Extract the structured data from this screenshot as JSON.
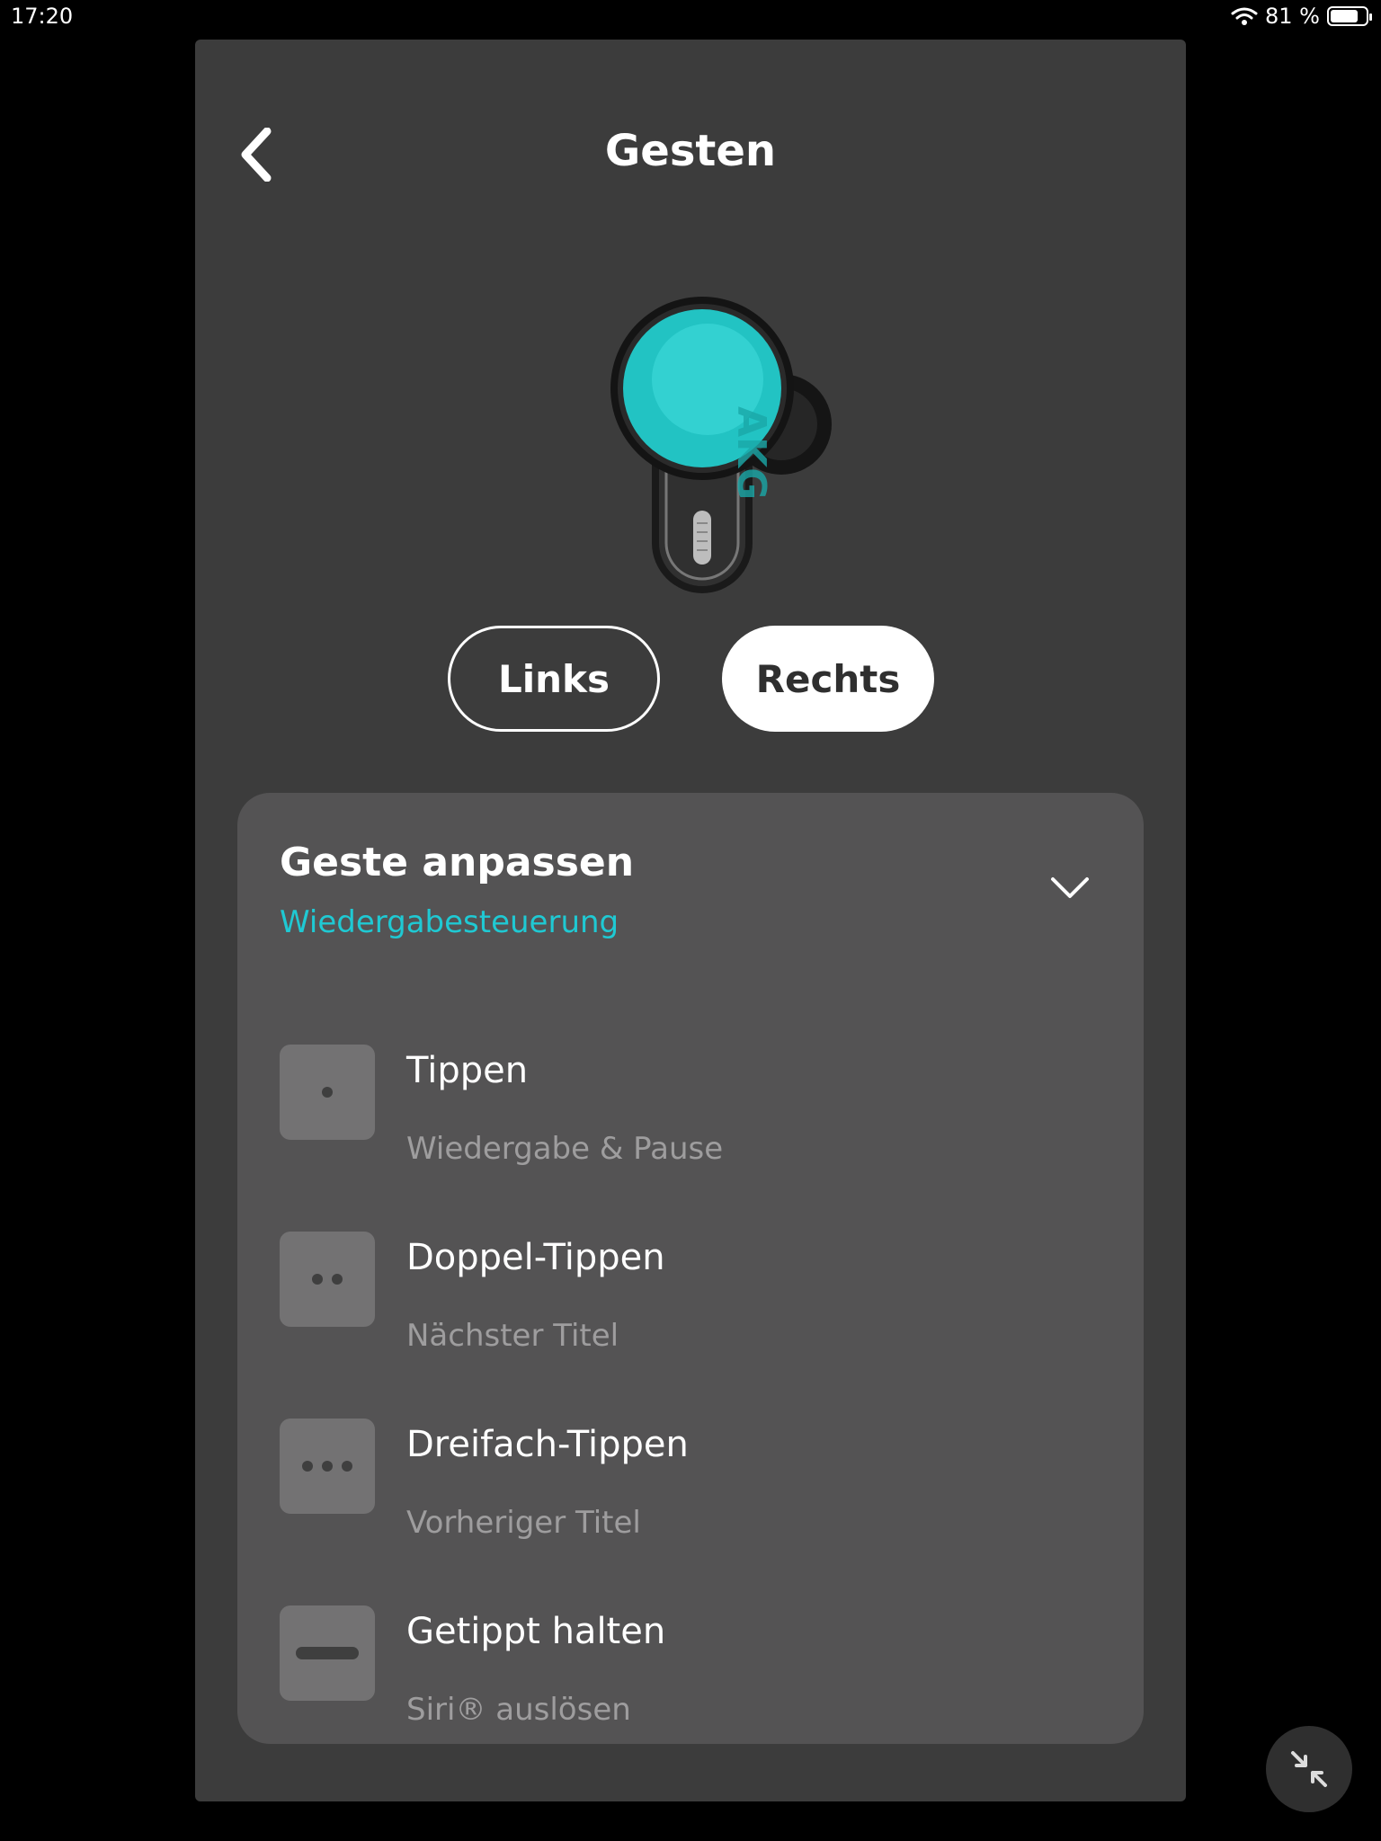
{
  "status": {
    "time": "17:20",
    "battery": "81 %",
    "battery_level": 0.81
  },
  "header": {
    "title": "Gesten"
  },
  "side_toggle": {
    "left": "Links",
    "right": "Rechts",
    "selected": "Rechts"
  },
  "customize": {
    "title": "Geste anpassen",
    "subtitle": "Wiedergabesteuerung",
    "gestures": [
      {
        "label": "Tippen",
        "value": "Wiedergabe & Pause",
        "icon": "single-dot-icon"
      },
      {
        "label": "Doppel-Tippen",
        "value": "Nächster Titel",
        "icon": "double-dot-icon"
      },
      {
        "label": "Dreifach-Tippen",
        "value": "Vorheriger Titel",
        "icon": "triple-dot-icon"
      },
      {
        "label": "Getippt halten",
        "value": "Siri® auslösen",
        "icon": "hold-bar-icon"
      }
    ]
  },
  "colors": {
    "accent": "#1fc9d3",
    "panel": "#3c3c3c",
    "card": "#545354",
    "earbud_accent": "#22c3c3"
  }
}
